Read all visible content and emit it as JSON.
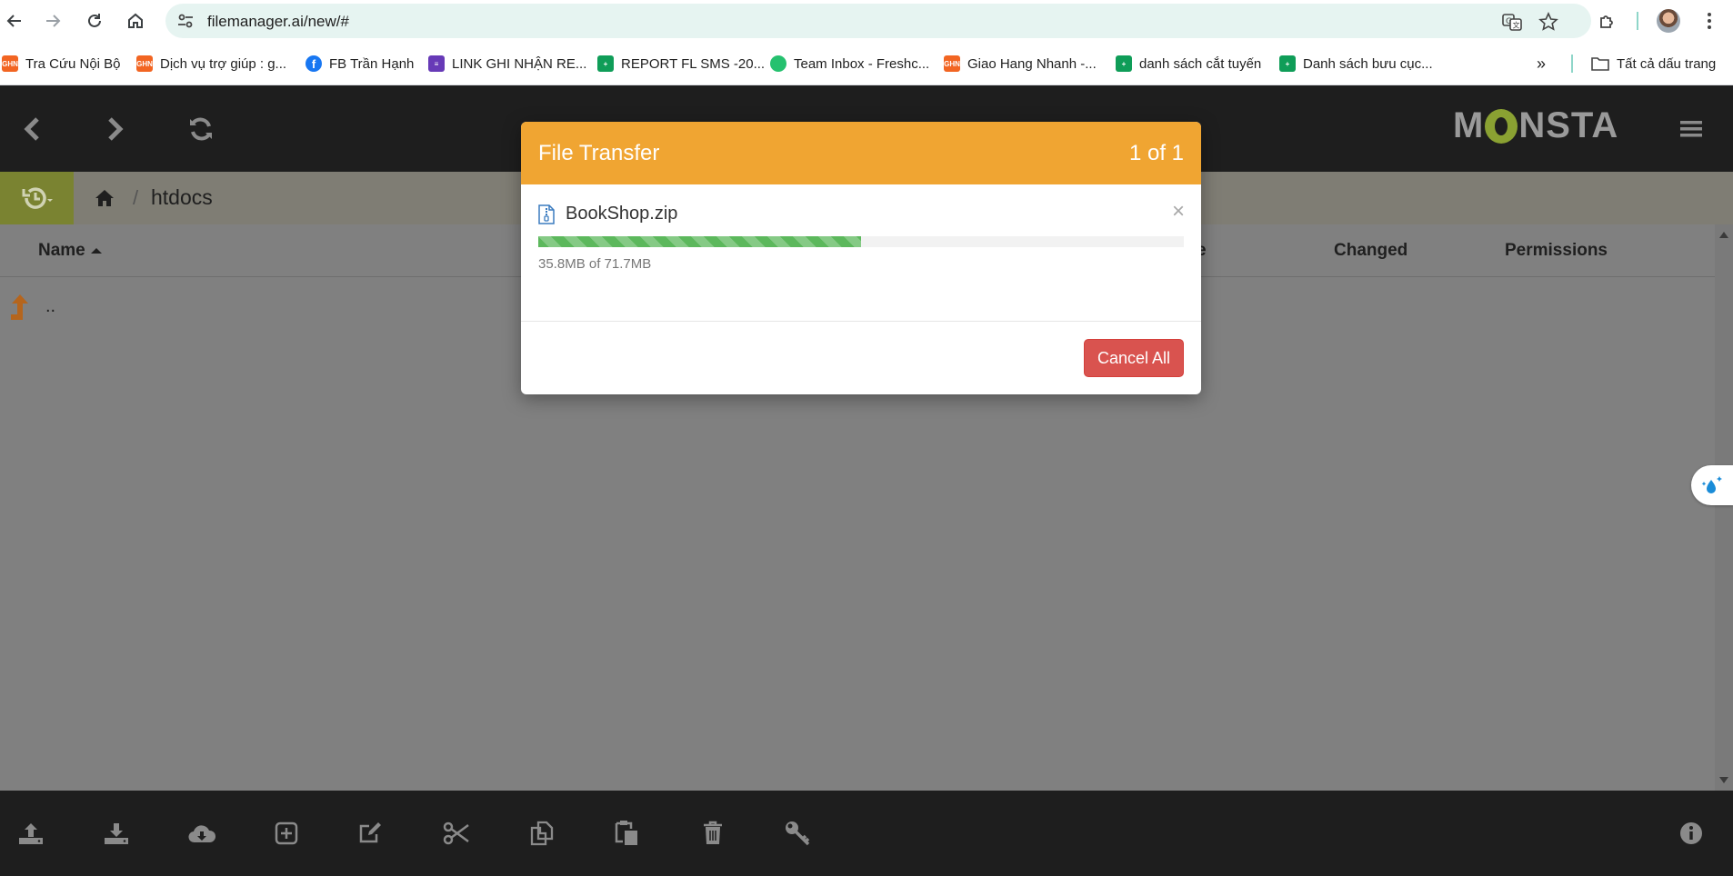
{
  "browser": {
    "url": "filemanager.ai/new/#",
    "bookmarks": [
      {
        "label": "Tra Cứu Nội Bộ",
        "icon": "ghn-icon"
      },
      {
        "label": "Dịch vụ trợ giúp : g...",
        "icon": "ghn-icon"
      },
      {
        "label": "FB Trần Hạnh",
        "icon": "facebook-icon"
      },
      {
        "label": "LINK GHI NHẬN RE...",
        "icon": "forms-icon"
      },
      {
        "label": "REPORT FL SMS -20...",
        "icon": "sheets-icon"
      },
      {
        "label": "Team Inbox - Freshc...",
        "icon": "freshchat-icon"
      },
      {
        "label": "Giao Hang Nhanh -...",
        "icon": "ghn-icon"
      },
      {
        "label": "danh sách cắt tuyến",
        "icon": "sheets-icon"
      },
      {
        "label": "Danh sách bưu cục...",
        "icon": "sheets-icon"
      }
    ],
    "all_bookmarks_label": "Tất cả dấu trang",
    "ghn_badge": "GHN"
  },
  "app": {
    "logo_left": "M",
    "logo_right": "NSTA",
    "breadcrumb": {
      "current": "htdocs"
    },
    "columns": {
      "name": "Name",
      "size": "e",
      "changed": "Changed",
      "permissions": "Permissions"
    },
    "parent_row_label": ".."
  },
  "modal": {
    "title": "File Transfer",
    "count": "1 of 1",
    "file_name": "BookShop.zip",
    "progress_text": "35.8MB of 71.7MB",
    "progress_fraction": 0.5,
    "close_glyph": "×",
    "cancel_label": "Cancel All"
  },
  "colors": {
    "header_bg": "#1e1e1e",
    "modal_header": "#f0a532",
    "progress": "#5cb85c",
    "cancel": "#d9534f",
    "logo_accent": "#8aa132"
  }
}
